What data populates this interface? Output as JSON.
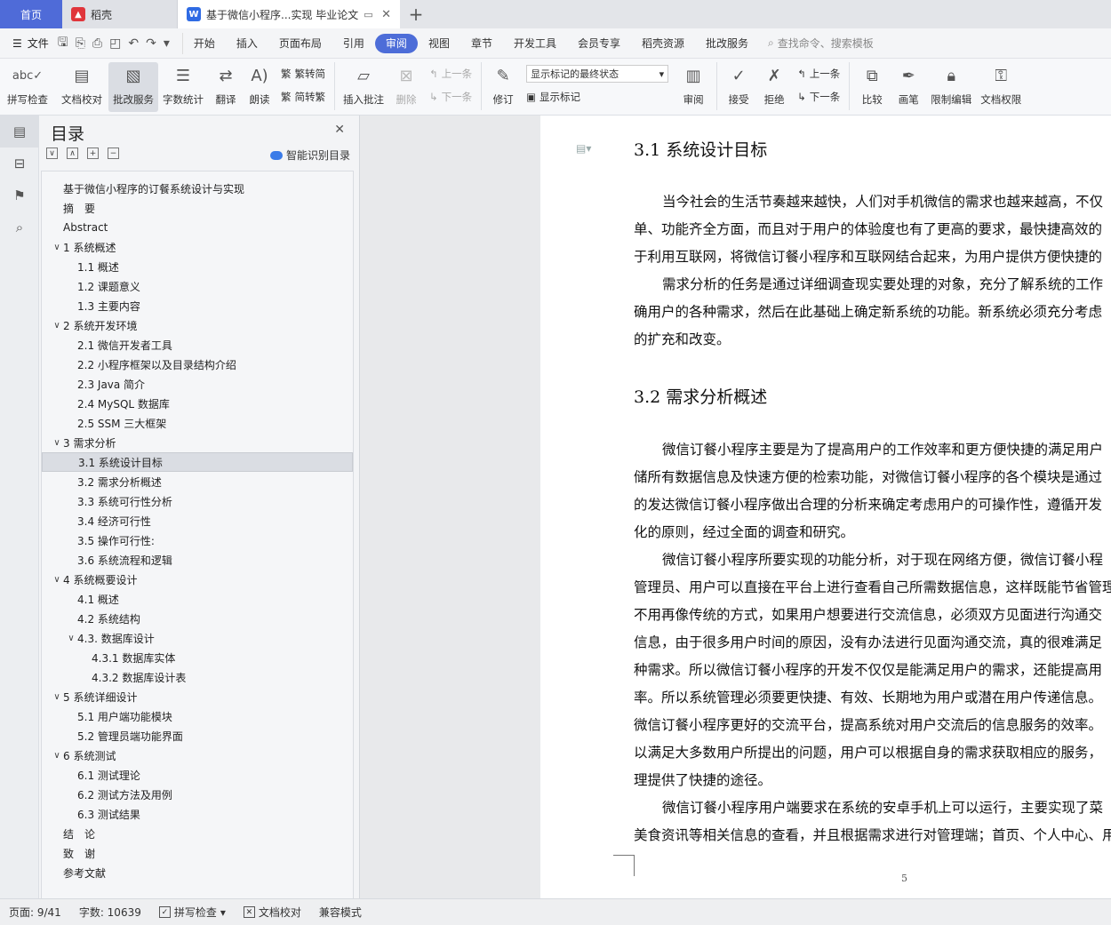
{
  "tabs": {
    "home": "首页",
    "daoke": "稻壳",
    "doc": "基于微信小程序...实现 毕业论文",
    "plus": "+"
  },
  "menu": {
    "file": "文件",
    "items": [
      "开始",
      "插入",
      "页面布局",
      "引用",
      "审阅",
      "视图",
      "章节",
      "开发工具",
      "会员专享",
      "稻壳资源",
      "批改服务"
    ],
    "active": "审阅",
    "search": "查找命令、搜索模板"
  },
  "ribbon": {
    "spellcheck": "拼写检查",
    "doc_proof": "文档校对",
    "review_service": "批改服务",
    "word_count": "字数统计",
    "translate": "翻译",
    "read_aloud": "朗读",
    "to_traditional": "繁转简",
    "to_simplified": "简转繁",
    "insert_comment": "插入批注",
    "delete": "删除",
    "prev": "上一条",
    "next": "下一条",
    "revise": "修订",
    "markup_select": "显示标记的最终状态",
    "show_markup": "显示标记",
    "review": "审阅",
    "accept": "接受",
    "reject": "拒绝",
    "prev2": "上一条",
    "next2": "下一条",
    "compare": "比较",
    "pen": "画笔",
    "restrict_edit": "限制编辑",
    "doc_permission": "文档权限"
  },
  "toc": {
    "title": "目录",
    "smart": "智能识别目录",
    "items": [
      {
        "text": "基于微信小程序的订餐系统设计与实现",
        "level": 0,
        "toggle": ""
      },
      {
        "text": "摘　要",
        "level": 0,
        "toggle": ""
      },
      {
        "text": "Abstract",
        "level": 0,
        "toggle": ""
      },
      {
        "text": "1  系统概述",
        "level": 0,
        "toggle": "∨"
      },
      {
        "text": "1.1  概述",
        "level": 1,
        "toggle": ""
      },
      {
        "text": "1.2 课题意义",
        "level": 1,
        "toggle": ""
      },
      {
        "text": "1.3  主要内容",
        "level": 1,
        "toggle": ""
      },
      {
        "text": "2  系统开发环境",
        "level": 0,
        "toggle": "∨"
      },
      {
        "text": "2.1 微信开发者工具",
        "level": 1,
        "toggle": ""
      },
      {
        "text": "2.2 小程序框架以及目录结构介绍",
        "level": 1,
        "toggle": ""
      },
      {
        "text": "2.3 Java 简介",
        "level": 1,
        "toggle": ""
      },
      {
        "text": "2.4 MySQL 数据库",
        "level": 1,
        "toggle": ""
      },
      {
        "text": "2.5 SSM 三大框架",
        "level": 1,
        "toggle": ""
      },
      {
        "text": "3  需求分析",
        "level": 0,
        "toggle": "∨"
      },
      {
        "text": "3.1  系统设计目标",
        "level": 1,
        "toggle": "",
        "active": true
      },
      {
        "text": "3.2 需求分析概述",
        "level": 1,
        "toggle": ""
      },
      {
        "text": "3.3  系统可行性分析",
        "level": 1,
        "toggle": ""
      },
      {
        "text": "3.4 经济可行性",
        "level": 1,
        "toggle": ""
      },
      {
        "text": "3.5 操作可行性:",
        "level": 1,
        "toggle": ""
      },
      {
        "text": "3.6 系统流程和逻辑",
        "level": 1,
        "toggle": ""
      },
      {
        "text": "4 系统概要设计",
        "level": 0,
        "toggle": "∨"
      },
      {
        "text": "4.1  概述",
        "level": 1,
        "toggle": ""
      },
      {
        "text": "4.2  系统结构",
        "level": 1,
        "toggle": ""
      },
      {
        "text": "4.3.  数据库设计",
        "level": 1,
        "toggle": "∨"
      },
      {
        "text": "4.3.1  数据库实体",
        "level": 2,
        "toggle": ""
      },
      {
        "text": "4.3.2  数据库设计表",
        "level": 2,
        "toggle": ""
      },
      {
        "text": "5 系统详细设计",
        "level": 0,
        "toggle": "∨"
      },
      {
        "text": "5.1 用户端功能模块",
        "level": 1,
        "toggle": ""
      },
      {
        "text": "5.2 管理员端功能界面",
        "level": 1,
        "toggle": ""
      },
      {
        "text": "6  系统测试",
        "level": 0,
        "toggle": "∨"
      },
      {
        "text": "6.1  测试理论",
        "level": 1,
        "toggle": ""
      },
      {
        "text": "6.2  测试方法及用例",
        "level": 1,
        "toggle": ""
      },
      {
        "text": "6.3 测试结果",
        "level": 1,
        "toggle": ""
      },
      {
        "text": "结　论",
        "level": 0,
        "toggle": ""
      },
      {
        "text": "致　谢",
        "level": 0,
        "toggle": ""
      },
      {
        "text": "参考文献",
        "level": 0,
        "toggle": ""
      }
    ]
  },
  "doc": {
    "h1": "3.1  系统设计目标",
    "p1": [
      "当今社会的生活节奏越来越快，人们对手机微信的需求也越来越高，不仅",
      "单、功能齐全方面，而且对于用户的体验度也有了更高的要求，最快捷高效的",
      "于利用互联网，将微信订餐小程序和互联网结合起来，为用户提供方便快捷的"
    ],
    "p2": [
      "需求分析的任务是通过详细调查现实要处理的对象，充分了解系统的工作",
      "确用户的各种需求，然后在此基础上确定新系统的功能。新系统必须充分考虑",
      "的扩充和改变。"
    ],
    "h2": "3.2 需求分析概述",
    "p3": [
      "微信订餐小程序主要是为了提高用户的工作效率和更方便快捷的满足用户",
      "储所有数据信息及快速方便的检索功能，对微信订餐小程序的各个模块是通过",
      "的发达微信订餐小程序做出合理的分析来确定考虑用户的可操作性，遵循开发",
      "化的原则，经过全面的调查和研究。"
    ],
    "p4": [
      "微信订餐小程序所要实现的功能分析，对于现在网络方便，微信订餐小程",
      "管理员、用户可以直接在平台上进行查看自己所需数据信息，这样既能节省管理",
      "不用再像传统的方式，如果用户想要进行交流信息，必须双方见面进行沟通交",
      "信息，由于很多用户时间的原因，没有办法进行见面沟通交流，真的很难满足",
      "种需求。所以微信订餐小程序的开发不仅仅是能满足用户的需求，还能提高用",
      "率。所以系统管理必须要更快捷、有效、长期地为用户或潜在用户传递信息。",
      "微信订餐小程序更好的交流平台，提高系统对用户交流后的信息服务的效率。",
      "以满足大多数用户所提出的问题，用户可以根据自身的需求获取相应的服务，",
      "理提供了快捷的途径。"
    ],
    "p5": [
      "微信订餐小程序用户端要求在系统的安卓手机上可以运行，主要实现了菜",
      "美食资讯等相关信息的查看，并且根据需求进行对管理端；首页、个人中心、用"
    ],
    "page_number": "5"
  },
  "status": {
    "page": "页面: 9/41",
    "words": "字数: 10639",
    "spell": "拼写检查",
    "proof": "文档校对",
    "compat": "兼容模式"
  }
}
